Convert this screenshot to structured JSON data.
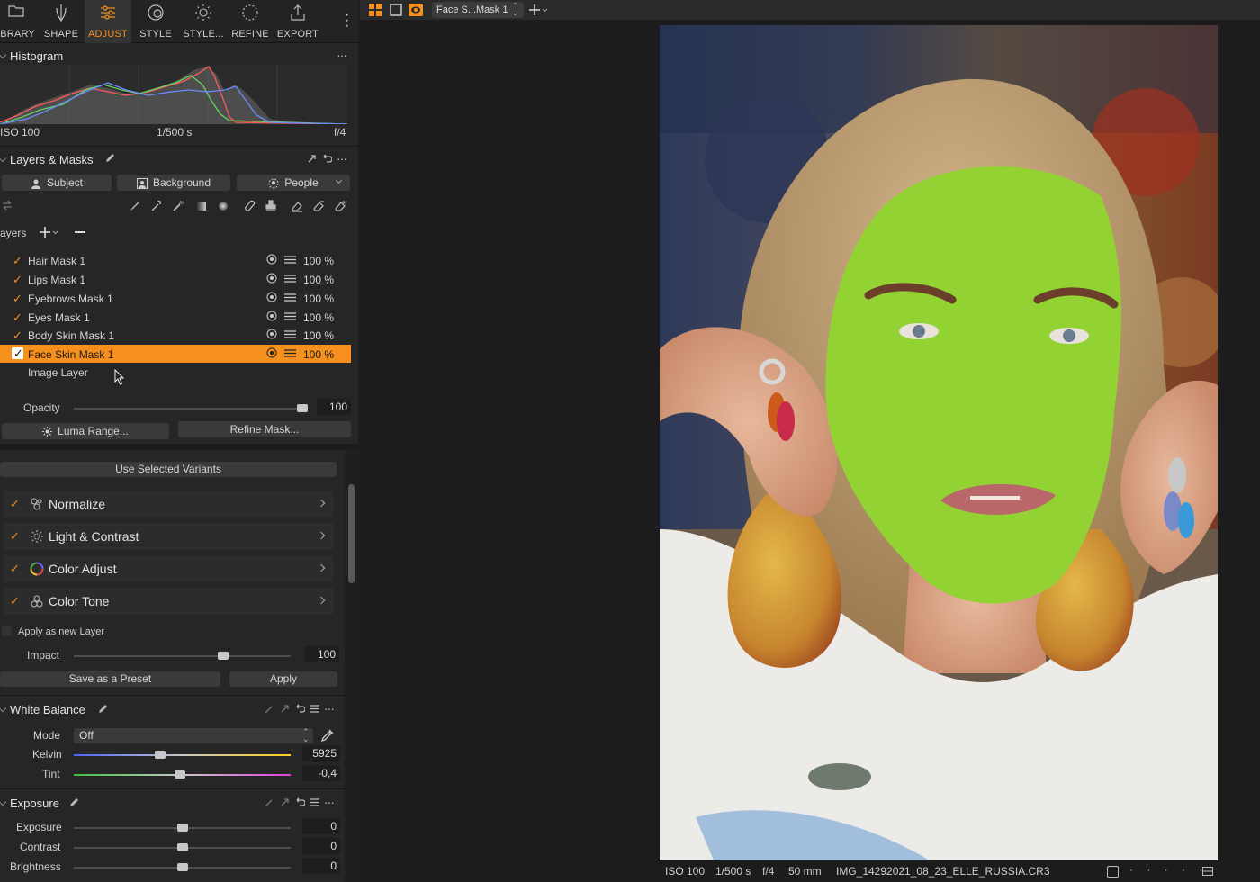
{
  "tabs": [
    {
      "label": "IBRARY",
      "icon": "folder-icon",
      "active": false
    },
    {
      "label": "SHAPE",
      "icon": "shape-icon",
      "active": false
    },
    {
      "label": "ADJUST",
      "icon": "sliders-icon",
      "active": true
    },
    {
      "label": "STYLE",
      "icon": "style-icon",
      "active": false
    },
    {
      "label": "STYLE...",
      "icon": "sun-icon",
      "active": false
    },
    {
      "label": "REFINE",
      "icon": "refine-icon",
      "active": false
    },
    {
      "label": "EXPORT",
      "icon": "export-icon",
      "active": false
    }
  ],
  "histogram": {
    "title": "Histogram",
    "iso": "ISO 100",
    "shutter": "1/500 s",
    "aperture": "f/4"
  },
  "layers_masks": {
    "title": "Layers & Masks",
    "buttons": {
      "subject": "Subject",
      "background": "Background",
      "people": "People"
    },
    "layers_label": "ayers",
    "layers": [
      {
        "name": "Hair Mask 1",
        "opacity": "100 %",
        "selected": false
      },
      {
        "name": "Lips Mask 1",
        "opacity": "100 %",
        "selected": false
      },
      {
        "name": "Eyebrows Mask 1",
        "opacity": "100 %",
        "selected": false
      },
      {
        "name": "Eyes Mask 1",
        "opacity": "100 %",
        "selected": false
      },
      {
        "name": "Body Skin Mask 1",
        "opacity": "100 %",
        "selected": false
      },
      {
        "name": "Face Skin Mask 1",
        "opacity": "100 %",
        "selected": true
      }
    ],
    "image_layer": "Image Layer",
    "opacity_label": "Opacity",
    "opacity_value": "100",
    "opacity_level": 1.0,
    "luma_range": "Luma Range...",
    "refine_mask": "Refine Mask..."
  },
  "variants": {
    "use_selected": "Use Selected Variants",
    "items": [
      {
        "label": "Normalize",
        "icon": "normalize-icon"
      },
      {
        "label": "Light & Contrast",
        "icon": "light-contrast-icon"
      },
      {
        "label": "Color Adjust",
        "icon": "color-wheel-icon"
      },
      {
        "label": "Color Tone",
        "icon": "color-tone-icon"
      }
    ],
    "apply_new_layer": "Apply as new Layer",
    "impact_label": "Impact",
    "impact_value": "100",
    "impact_level": 0.69,
    "save_preset": "Save as a Preset",
    "apply": "Apply"
  },
  "white_balance": {
    "title": "White Balance",
    "mode_label": "Mode",
    "mode_value": "Off",
    "kelvin_label": "Kelvin",
    "kelvin_value": "5925",
    "kelvin_level": 0.4,
    "tint_label": "Tint",
    "tint_value": "-0,4",
    "tint_level": 0.49
  },
  "exposure": {
    "title": "Exposure",
    "rows": [
      {
        "label": "Exposure",
        "value": "0"
      },
      {
        "label": "Contrast",
        "value": "0"
      },
      {
        "label": "Brightness",
        "value": "0"
      }
    ]
  },
  "topbar": {
    "variant_name": "Face S...Mask 1"
  },
  "status": {
    "iso": "ISO 100",
    "shutter": "1/500 s",
    "aperture": "f/4",
    "focal": "50 mm",
    "filename": "IMG_14292021_08_23_ELLE_RUSSIA.CR3"
  },
  "colors": {
    "accent": "#f5901f",
    "mask_overlay": "#93d233",
    "panel_bg": "#262626"
  }
}
